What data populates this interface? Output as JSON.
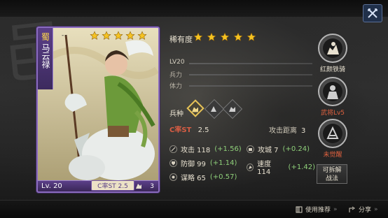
{
  "card": {
    "faction": "蜀",
    "name": "马云禄",
    "menu_mark": "--",
    "star_count": 5,
    "level": "Lv. 20",
    "cost": "C率ST 2.5",
    "troop_count": "3"
  },
  "info": {
    "rarity_label": "稀有度",
    "rarity_stars": 5,
    "level": "LV20",
    "troops_label": "兵力",
    "stamina_label": "体力",
    "troop_type_label": "兵种",
    "cost_label": "C率ST",
    "cost_value": "2.5",
    "range_label": "攻击距离",
    "range_value": "3",
    "stats": [
      {
        "label": "攻击 118",
        "bonus": "(+1.56)",
        "icon": "sword-icon"
      },
      {
        "label": "攻城 7",
        "bonus": "(+0.24)",
        "icon": "siege-icon"
      },
      {
        "label": "防御 99",
        "bonus": "(+1.14)",
        "icon": "shield-icon"
      },
      {
        "label": "速度 114",
        "bonus": "(+1.42)",
        "icon": "speed-icon"
      },
      {
        "label": "谋略 65",
        "bonus": "(+0.57)",
        "icon": "strategy-icon"
      }
    ]
  },
  "right": {
    "items": [
      {
        "label": "红颜铁骑",
        "color": "#e8e1d0"
      },
      {
        "label": "武将Lv5",
        "color": "#e0613f"
      },
      {
        "label": "未觉醒",
        "color": "#e0613f"
      }
    ],
    "zhanfa_line1": "可拆解",
    "zhanfa_line2": "战法"
  },
  "bottom": {
    "recommend": "使用推荐",
    "share": "分享"
  },
  "colors": {
    "accent_purple": "#8a6bbf",
    "gold": "#f5c322",
    "bonus_green": "#8fd07a",
    "warn_red": "#e0613f"
  }
}
